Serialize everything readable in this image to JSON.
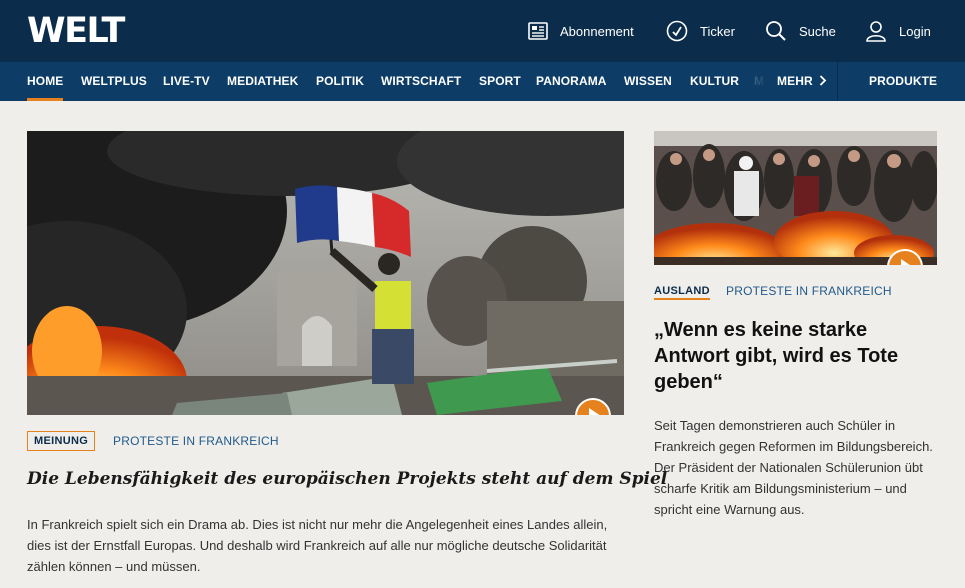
{
  "brand": {
    "logo": "WELT"
  },
  "utility": {
    "abonnement": "Abonnement",
    "ticker": "Ticker",
    "suche": "Suche",
    "login": "Login"
  },
  "nav": {
    "items": [
      "HOME",
      "WELTPLUS",
      "LIVE-TV",
      "MEDIATHEK",
      "POLITIK",
      "WIRTSCHAFT",
      "SPORT",
      "PANORAMA",
      "WISSEN",
      "KULTUR",
      "M"
    ],
    "more": "MEHR",
    "products": "PRODUKTE",
    "active": "HOME"
  },
  "main_article": {
    "badge": "MEINUNG",
    "topic": "PROTESTE IN FRANKREICH",
    "headline": "Die Lebensfähigkeit des europäischen Projekts steht auf dem Spiel",
    "teaser": "In Frankreich spielt sich ein Drama ab. Dies ist nicht nur mehr die Angelegenheit eines Landes allein, dies ist der Ernstfall Europas. Und deshalb wird Frankreich auf alle nur mögliche deutsche Solidarität zählen können – und müssen."
  },
  "side_article": {
    "badge": "AUSLAND",
    "topic": "PROTESTE IN FRANKREICH",
    "headline": "„Wenn es keine starke Antwort gibt, wird es Tote geben“",
    "teaser": "Seit Tagen demonstrieren auch Schüler in Frankreich gegen Reformen im Bildungsbereich. Der Präsident der Nationalen Schülerunion übt scharfe Kritik am Bildungsministerium – und spricht eine Warnung aus."
  },
  "colors": {
    "header": "#0b2c4a",
    "nav": "#0d3d66",
    "accent": "#e6821e",
    "background": "#f0eeeb",
    "topic": "#1f5a8a"
  },
  "icons": [
    "newspaper-icon",
    "clock-icon",
    "search-icon",
    "user-icon",
    "chevron-right-icon",
    "play-icon"
  ]
}
